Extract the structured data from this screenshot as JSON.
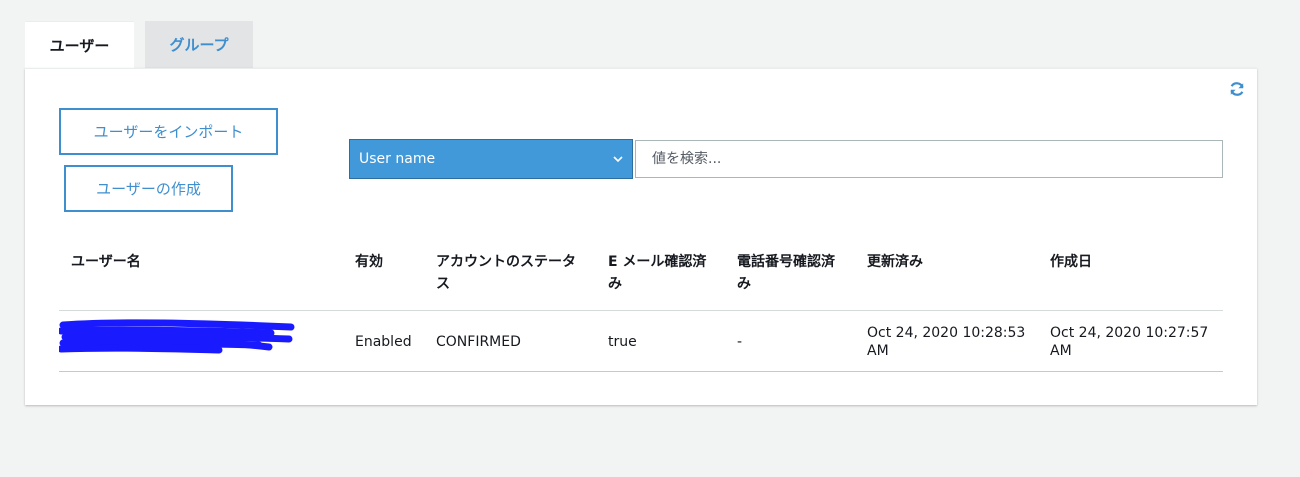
{
  "tabs": [
    {
      "label": "ユーザー",
      "active": true
    },
    {
      "label": "グループ",
      "active": false
    }
  ],
  "toolbar": {
    "import_label": "ユーザーをインポート",
    "create_label": "ユーザーの作成",
    "filter_selected": "User name",
    "search_placeholder": "値を検索..."
  },
  "icons": {
    "refresh": "refresh-icon",
    "dropdown": "chevron-down-icon"
  },
  "colors": {
    "accent": "#3f8fcf",
    "select_bg": "#4299d9",
    "redaction": "#1a1aff"
  },
  "table": {
    "headers": [
      "ユーザー名",
      "有効",
      "アカウントのステータス",
      "E メール確認済み",
      "電話番号確認済み",
      "更新済み",
      "作成日"
    ],
    "rows": [
      {
        "username": "",
        "enabled": "Enabled",
        "status": "CONFIRMED",
        "email_verified": "true",
        "phone_verified": "-",
        "updated": "Oct 24, 2020 10:28:53 AM",
        "created": "Oct 24, 2020 10:27:57 AM"
      }
    ]
  }
}
